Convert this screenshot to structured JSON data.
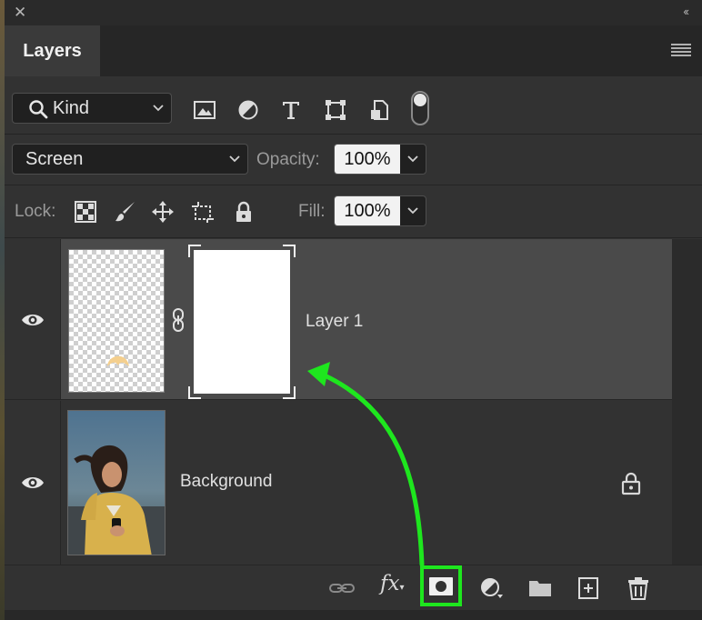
{
  "panel": {
    "tab_label": "Layers"
  },
  "filter_row": {
    "kind_label": "Kind",
    "icons": [
      "image-filter-icon",
      "adjustment-filter-icon",
      "type-filter-icon",
      "shape-filter-icon",
      "smart-object-filter-icon",
      "filter-toggle"
    ]
  },
  "blend_row": {
    "blend_mode": "Screen",
    "opacity_label": "Opacity:",
    "opacity_value": "100%"
  },
  "lock_row": {
    "lock_label": "Lock:",
    "fill_label": "Fill:",
    "fill_value": "100%",
    "icons": [
      "lock-transparent-pixels-icon",
      "lock-image-pixels-icon",
      "lock-position-icon",
      "lock-artboard-icon",
      "lock-all-icon"
    ]
  },
  "layers": [
    {
      "name": "Layer 1",
      "visible": true,
      "selected": true,
      "has_mask": true,
      "linked": true
    },
    {
      "name": "Background",
      "visible": true,
      "selected": false,
      "locked": true
    }
  ],
  "bottom_toolbar": {
    "icons": [
      "link-layers-icon",
      "fx-icon",
      "add-mask-icon",
      "adjustment-layer-icon",
      "group-folder-icon",
      "new-layer-icon",
      "delete-icon"
    ],
    "fx_label": "fx",
    "highlighted": "add-mask-icon"
  },
  "annotation": {
    "arrow_color": "#1ee61e",
    "highlight_color": "#1ee61e"
  }
}
